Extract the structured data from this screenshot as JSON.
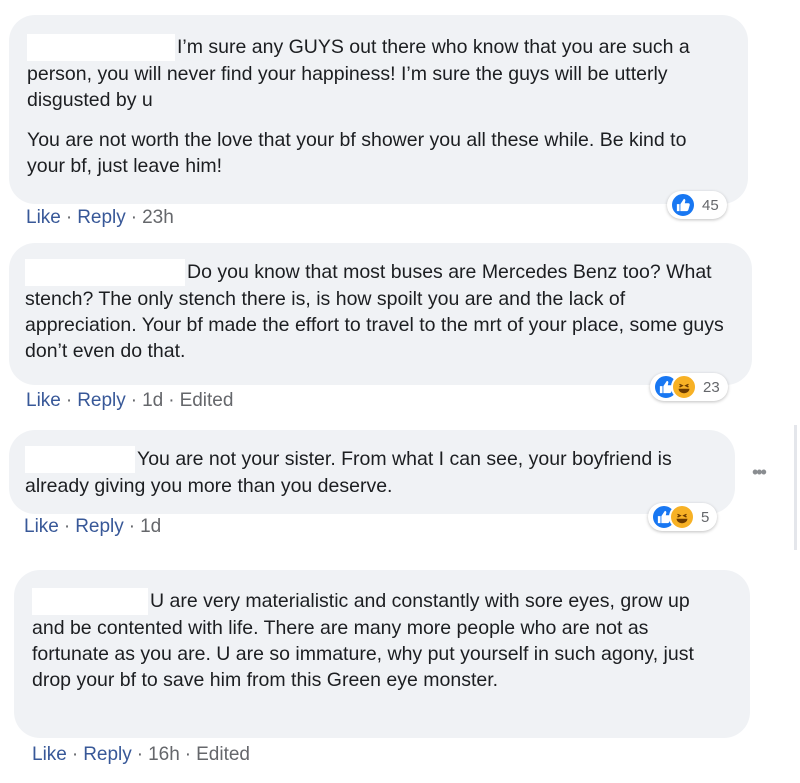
{
  "comments": [
    {
      "paragraphs": [
        "I’m sure any GUYS out there who know that you are such a person, you will never find your happiness! I’m sure the guys will be utterly disgusted by u",
        "You are not worth the love that your bf shower you all these while. Be kind to your bf, just leave him!"
      ],
      "actions": {
        "like": "Like",
        "reply": "Reply",
        "time": "23h",
        "edited": ""
      },
      "reactions": {
        "types": [
          "like"
        ],
        "count": "45"
      }
    },
    {
      "paragraphs": [
        "Do you know that most buses are Mercedes Benz too? What stench? The only stench there is, is how spoilt you are and the lack of appreciation. Your bf made the effort to travel to the mrt of your place, some guys don’t even do that."
      ],
      "actions": {
        "like": "Like",
        "reply": "Reply",
        "time": "1d",
        "edited": "Edited"
      },
      "reactions": {
        "types": [
          "like",
          "haha"
        ],
        "count": "23"
      }
    },
    {
      "paragraphs": [
        "You are not your sister. From what I can see, your boyfriend is already giving you more than you deserve."
      ],
      "actions": {
        "like": "Like",
        "reply": "Reply",
        "time": "1d",
        "edited": ""
      },
      "reactions": {
        "types": [
          "like",
          "haha"
        ],
        "count": "5"
      }
    },
    {
      "paragraphs": [
        "U are very materialistic and constantly with sore eyes, grow up and be contented with life. There are many more people who are not as fortunate as you are. U are so immature, why put yourself in such agony, just drop your bf to save him from this Green eye monster."
      ],
      "actions": {
        "like": "Like",
        "reply": "Reply",
        "time": "16h",
        "edited": "Edited"
      },
      "reactions": null
    }
  ],
  "colors": {
    "bubble": "#f0f2f5",
    "link": "#385898",
    "meta": "#65676b",
    "like": "#1877f2",
    "haha": "#f7b125"
  },
  "icons": [
    "like-reaction-icon",
    "haha-reaction-icon",
    "more-options-icon"
  ]
}
